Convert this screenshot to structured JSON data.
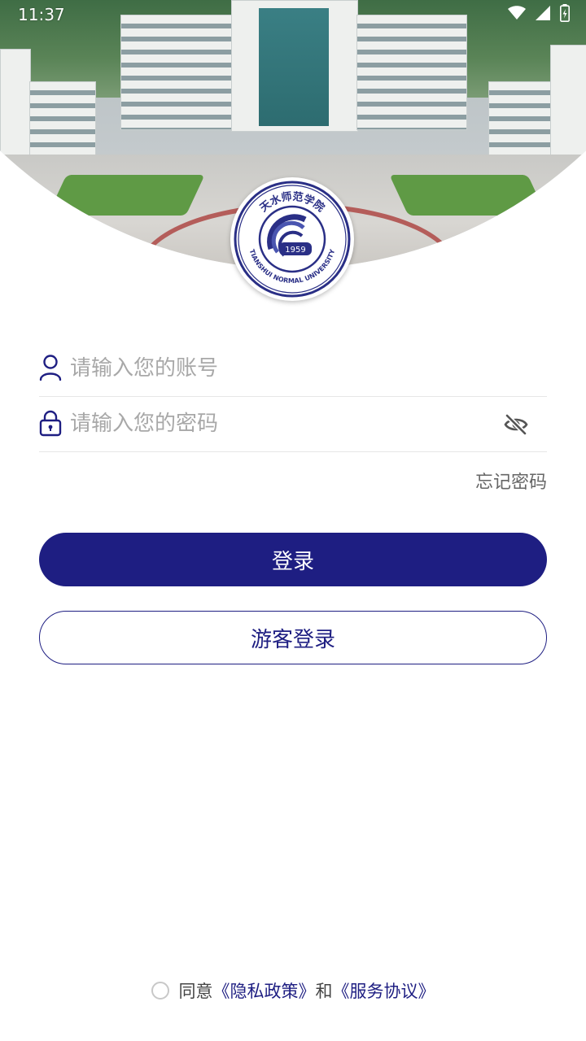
{
  "status_bar": {
    "time": "11:37"
  },
  "header": {
    "emblem": {
      "chinese_name": "天水师范学院",
      "english_name": "TIANSHUI NORMAL UNIVERSITY",
      "year": "1959"
    }
  },
  "login_form": {
    "account_placeholder": "请输入您的账号",
    "password_placeholder": "请输入您的密码",
    "forgot_password": "忘记密码",
    "login_button": "登录",
    "guest_login_button": "游客登录"
  },
  "agreement": {
    "prefix": "同意",
    "privacy_link": "《隐私政策》",
    "and": "和",
    "service_link": "《服务协议》"
  },
  "colors": {
    "primary": "#1e1e82",
    "placeholder": "#a8a8a8",
    "divider": "#e6e6e6"
  },
  "icons": {
    "account": "person-icon",
    "password": "lock-icon",
    "toggle_password": "eye-off-icon"
  }
}
